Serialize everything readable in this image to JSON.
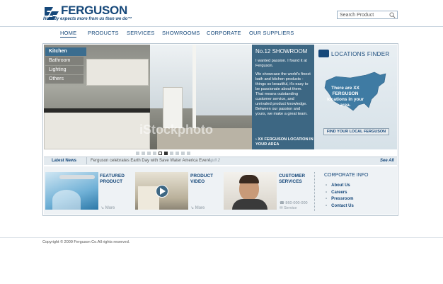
{
  "brand": {
    "name": "FERGUSON",
    "tagline": "Nobody expects more from us than we do™",
    "accent": "#16487a"
  },
  "search": {
    "placeholder": "Search Product"
  },
  "nav": [
    "HOME",
    "PRODUCTS",
    "SERVICES",
    "SHOWROOMS",
    "CORPORATE",
    "OUR SUPPLIERS"
  ],
  "hero": {
    "submenu": [
      "Kitchen",
      "Bathroom",
      "Lighting",
      "Others"
    ],
    "watermark": "iStockphoto"
  },
  "showroom": {
    "title": "No.12 SHOWROOM",
    "p1": "I wanted passion. I found it at Ferguson.",
    "p2": "We showcase the world's finest bath and kitchen products - things so beautiful, it's easy to be passionate about them. That means outstanding customer service, and unrivaled product knowledge. Between our passion and yours, we make a great team.",
    "location": "XX FERGUSON LOCATION IN YOUR AREA"
  },
  "finder": {
    "title": "LOCATIONS FINDER",
    "text": "There are XX FERGUSON locations in your area.",
    "button": "FIND YOUR LOCAL FERGUSON"
  },
  "slides": {
    "count": 10,
    "current": 6
  },
  "news": {
    "label": "Latest News",
    "headline": "Ferguson celebrates Earth Day with Save Water America Event",
    "date": "April 2",
    "see_all": "See All"
  },
  "cards": [
    {
      "title1": "FEATURED",
      "title2": "PRODUCT",
      "more": "More"
    },
    {
      "title1": "PRODUCT",
      "title2": "VIDEO",
      "more": "More"
    },
    {
      "title1": "CUSTOMER",
      "title2": "SERVICES",
      "phone": "860-000-000",
      "service": "Service"
    }
  ],
  "corporate": {
    "title": "CORPORATE INFO",
    "links": [
      "About Us",
      "Careers",
      "Pressroom",
      "Contact Us"
    ]
  },
  "footer": {
    "copyright": "Copyright © 2009 Ferguson Co.All rights reserved."
  }
}
